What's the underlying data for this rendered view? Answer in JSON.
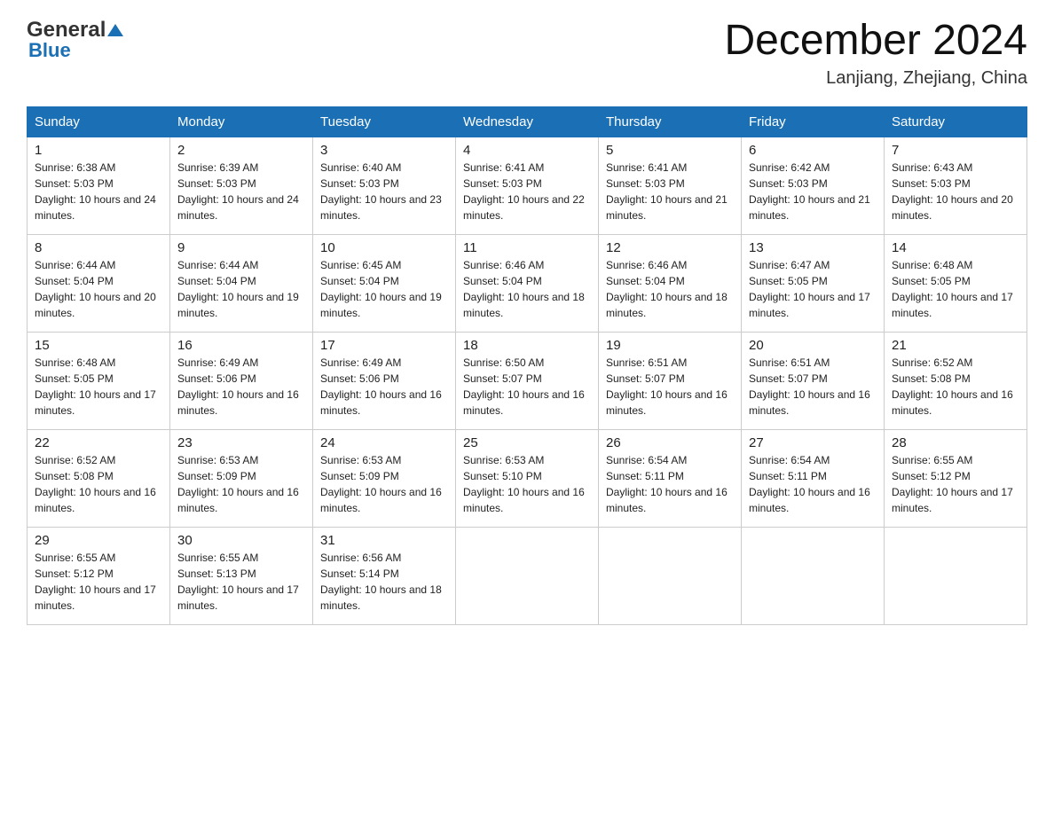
{
  "header": {
    "logo_general": "General",
    "logo_blue": "Blue",
    "month_title": "December 2024",
    "location": "Lanjiang, Zhejiang, China"
  },
  "days_of_week": [
    "Sunday",
    "Monday",
    "Tuesday",
    "Wednesday",
    "Thursday",
    "Friday",
    "Saturday"
  ],
  "weeks": [
    [
      {
        "day": "1",
        "sunrise": "6:38 AM",
        "sunset": "5:03 PM",
        "daylight": "10 hours and 24 minutes."
      },
      {
        "day": "2",
        "sunrise": "6:39 AM",
        "sunset": "5:03 PM",
        "daylight": "10 hours and 24 minutes."
      },
      {
        "day": "3",
        "sunrise": "6:40 AM",
        "sunset": "5:03 PM",
        "daylight": "10 hours and 23 minutes."
      },
      {
        "day": "4",
        "sunrise": "6:41 AM",
        "sunset": "5:03 PM",
        "daylight": "10 hours and 22 minutes."
      },
      {
        "day": "5",
        "sunrise": "6:41 AM",
        "sunset": "5:03 PM",
        "daylight": "10 hours and 21 minutes."
      },
      {
        "day": "6",
        "sunrise": "6:42 AM",
        "sunset": "5:03 PM",
        "daylight": "10 hours and 21 minutes."
      },
      {
        "day": "7",
        "sunrise": "6:43 AM",
        "sunset": "5:03 PM",
        "daylight": "10 hours and 20 minutes."
      }
    ],
    [
      {
        "day": "8",
        "sunrise": "6:44 AM",
        "sunset": "5:04 PM",
        "daylight": "10 hours and 20 minutes."
      },
      {
        "day": "9",
        "sunrise": "6:44 AM",
        "sunset": "5:04 PM",
        "daylight": "10 hours and 19 minutes."
      },
      {
        "day": "10",
        "sunrise": "6:45 AM",
        "sunset": "5:04 PM",
        "daylight": "10 hours and 19 minutes."
      },
      {
        "day": "11",
        "sunrise": "6:46 AM",
        "sunset": "5:04 PM",
        "daylight": "10 hours and 18 minutes."
      },
      {
        "day": "12",
        "sunrise": "6:46 AM",
        "sunset": "5:04 PM",
        "daylight": "10 hours and 18 minutes."
      },
      {
        "day": "13",
        "sunrise": "6:47 AM",
        "sunset": "5:05 PM",
        "daylight": "10 hours and 17 minutes."
      },
      {
        "day": "14",
        "sunrise": "6:48 AM",
        "sunset": "5:05 PM",
        "daylight": "10 hours and 17 minutes."
      }
    ],
    [
      {
        "day": "15",
        "sunrise": "6:48 AM",
        "sunset": "5:05 PM",
        "daylight": "10 hours and 17 minutes."
      },
      {
        "day": "16",
        "sunrise": "6:49 AM",
        "sunset": "5:06 PM",
        "daylight": "10 hours and 16 minutes."
      },
      {
        "day": "17",
        "sunrise": "6:49 AM",
        "sunset": "5:06 PM",
        "daylight": "10 hours and 16 minutes."
      },
      {
        "day": "18",
        "sunrise": "6:50 AM",
        "sunset": "5:07 PM",
        "daylight": "10 hours and 16 minutes."
      },
      {
        "day": "19",
        "sunrise": "6:51 AM",
        "sunset": "5:07 PM",
        "daylight": "10 hours and 16 minutes."
      },
      {
        "day": "20",
        "sunrise": "6:51 AM",
        "sunset": "5:07 PM",
        "daylight": "10 hours and 16 minutes."
      },
      {
        "day": "21",
        "sunrise": "6:52 AM",
        "sunset": "5:08 PM",
        "daylight": "10 hours and 16 minutes."
      }
    ],
    [
      {
        "day": "22",
        "sunrise": "6:52 AM",
        "sunset": "5:08 PM",
        "daylight": "10 hours and 16 minutes."
      },
      {
        "day": "23",
        "sunrise": "6:53 AM",
        "sunset": "5:09 PM",
        "daylight": "10 hours and 16 minutes."
      },
      {
        "day": "24",
        "sunrise": "6:53 AM",
        "sunset": "5:09 PM",
        "daylight": "10 hours and 16 minutes."
      },
      {
        "day": "25",
        "sunrise": "6:53 AM",
        "sunset": "5:10 PM",
        "daylight": "10 hours and 16 minutes."
      },
      {
        "day": "26",
        "sunrise": "6:54 AM",
        "sunset": "5:11 PM",
        "daylight": "10 hours and 16 minutes."
      },
      {
        "day": "27",
        "sunrise": "6:54 AM",
        "sunset": "5:11 PM",
        "daylight": "10 hours and 16 minutes."
      },
      {
        "day": "28",
        "sunrise": "6:55 AM",
        "sunset": "5:12 PM",
        "daylight": "10 hours and 17 minutes."
      }
    ],
    [
      {
        "day": "29",
        "sunrise": "6:55 AM",
        "sunset": "5:12 PM",
        "daylight": "10 hours and 17 minutes."
      },
      {
        "day": "30",
        "sunrise": "6:55 AM",
        "sunset": "5:13 PM",
        "daylight": "10 hours and 17 minutes."
      },
      {
        "day": "31",
        "sunrise": "6:56 AM",
        "sunset": "5:14 PM",
        "daylight": "10 hours and 18 minutes."
      },
      null,
      null,
      null,
      null
    ]
  ],
  "labels": {
    "sunrise_prefix": "Sunrise: ",
    "sunset_prefix": "Sunset: ",
    "daylight_prefix": "Daylight: "
  }
}
